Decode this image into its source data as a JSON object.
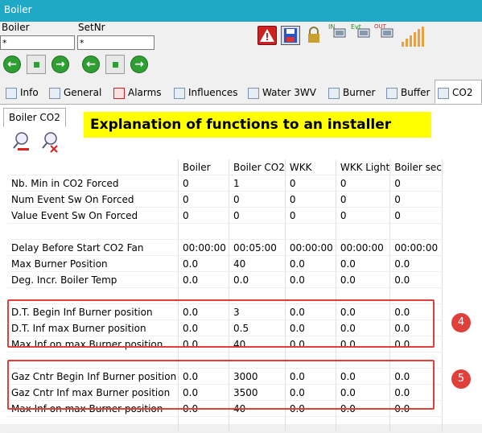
{
  "window": {
    "title": "Boiler"
  },
  "selectors": {
    "boiler_label": "Boiler",
    "boiler_value": "*",
    "setnr_label": "SetNr",
    "setnr_value": "*"
  },
  "toolbar": {
    "icons": [
      "alarm-icon",
      "save-icon",
      "lock-icon",
      "input-icon",
      "event-icon",
      "output-icon",
      "graph-icon"
    ],
    "labels": {
      "in": "IN",
      "evt": "Evt",
      "out": "OUT"
    }
  },
  "tabs": [
    "Info",
    "General",
    "Alarms",
    "Influences",
    "Water 3WV",
    "Burner",
    "Buffer",
    "CO2"
  ],
  "active_tab": "CO2",
  "subtab": "Boiler CO2",
  "banner": "Explanation of functions to an installer",
  "table": {
    "headers": [
      "",
      "Boiler",
      "Boiler CO2",
      "WKK",
      "WKK Light",
      "Boiler sec"
    ],
    "rows": [
      [
        "Nb. Min in CO2 Forced",
        "0",
        "1",
        "0",
        "0",
        "0"
      ],
      [
        "Num Event Sw On Forced",
        "0",
        "0",
        "0",
        "0",
        "0"
      ],
      [
        "Value Event Sw On Forced",
        "0",
        "0",
        "0",
        "0",
        "0"
      ],
      [
        "",
        "",
        "",
        "",
        "",
        ""
      ],
      [
        "Delay Before Start CO2 Fan",
        "00:00:00",
        "00:05:00",
        "00:00:00",
        "00:00:00",
        "00:00:00"
      ],
      [
        "Max Burner Position",
        "0.0",
        "40",
        "0.0",
        "0.0",
        "0.0"
      ],
      [
        "Deg. Incr. Boiler Temp",
        "0.0",
        "0.0",
        "0.0",
        "0.0",
        "0.0"
      ],
      [
        "",
        "",
        "",
        "",
        "",
        ""
      ],
      [
        "D.T. Begin Inf Burner position",
        "0.0",
        "3",
        "0.0",
        "0.0",
        "0.0"
      ],
      [
        "D.T. Inf max Burner position",
        "0.0",
        "0.5",
        "0.0",
        "0.0",
        "0.0"
      ],
      [
        "Max Inf on max Burner position",
        "0.0",
        "40",
        "0.0",
        "0.0",
        "0.0"
      ],
      [
        "",
        "",
        "",
        "",
        "",
        ""
      ],
      [
        "Gaz Cntr Begin Inf Burner position",
        "0.0",
        "3000",
        "0.0",
        "0.0",
        "0.0"
      ],
      [
        "Gaz Cntr Inf max Burner position",
        "0.0",
        "3500",
        "0.0",
        "0.0",
        "0.0"
      ],
      [
        "Max Inf on max Burner position",
        "0.0",
        "40",
        "0.0",
        "0.0",
        "0.0"
      ],
      [
        "",
        "",
        "",
        "",
        "",
        ""
      ]
    ]
  },
  "annotations": {
    "badge_1": "4",
    "badge_2": "5",
    "color": "#e0403a"
  }
}
